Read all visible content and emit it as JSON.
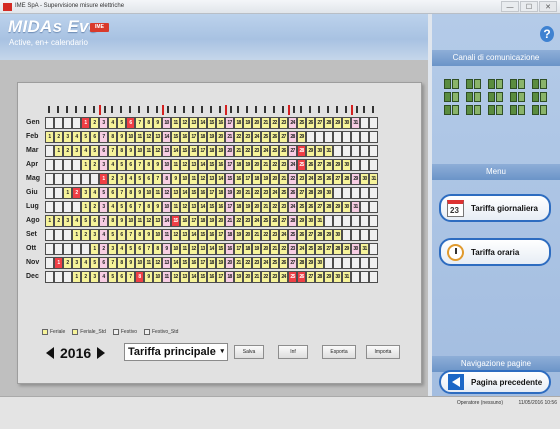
{
  "window": {
    "title": "IME SpA - Supervisione misure elettriche",
    "controls": [
      "—",
      "☐",
      "✕"
    ]
  },
  "header": {
    "app_name": "MIDAs Evo",
    "badge": "IME",
    "subtitle": "Active, en+ calendario"
  },
  "calendar": {
    "year": "2016",
    "months": [
      {
        "label": "Gen",
        "start": 4,
        "days": 31,
        "holidays": [
          1,
          6
        ]
      },
      {
        "label": "Feb",
        "start": 0,
        "days": 29,
        "holidays": []
      },
      {
        "label": "Mar",
        "start": 1,
        "days": 31,
        "holidays": [
          28
        ]
      },
      {
        "label": "Apr",
        "start": 4,
        "days": 30,
        "holidays": [
          25
        ]
      },
      {
        "label": "Mag",
        "start": 6,
        "days": 31,
        "holidays": [
          1
        ]
      },
      {
        "label": "Giu",
        "start": 2,
        "days": 30,
        "holidays": [
          2
        ]
      },
      {
        "label": "Lug",
        "start": 4,
        "days": 31,
        "holidays": []
      },
      {
        "label": "Ago",
        "start": 0,
        "days": 31,
        "holidays": [
          15
        ]
      },
      {
        "label": "Set",
        "start": 3,
        "days": 30,
        "holidays": []
      },
      {
        "label": "Ott",
        "start": 5,
        "days": 31,
        "holidays": []
      },
      {
        "label": "Nov",
        "start": 1,
        "days": 30,
        "holidays": [
          1
        ]
      },
      {
        "label": "Dec",
        "start": 3,
        "days": 31,
        "holidays": [
          8,
          25,
          26
        ]
      }
    ],
    "legend": [
      "Feriale",
      "Feriale_Std",
      "Festivo",
      "Festivo_Std"
    ],
    "colors": {
      "weekday": "#f6f39a",
      "sunday": "#f7cde3",
      "holiday": "#ef3f45",
      "empty": "#f0f0f0"
    }
  },
  "controls": {
    "year_prev": "◀",
    "year_next": "▶",
    "tariff_select": "Tariffa principale",
    "buttons": [
      "Salva",
      "Inf",
      "Esporta",
      "Importa"
    ]
  },
  "sidebar": {
    "channels_title": "Canali di comunicazione",
    "menu_title": "Menu",
    "menu_items": [
      {
        "label": "Tariffa giornaliera",
        "icon": "calendar-icon",
        "icon_text": "23"
      },
      {
        "label": "Tariffa oraria",
        "icon": "clock-icon"
      }
    ],
    "nav_title": "Navigazione pagine",
    "nav_button": "Pagina precedente",
    "help": "?"
  },
  "status": {
    "user": "Operatore (nessuno)",
    "datetime": "11/05/2016 10:56"
  }
}
